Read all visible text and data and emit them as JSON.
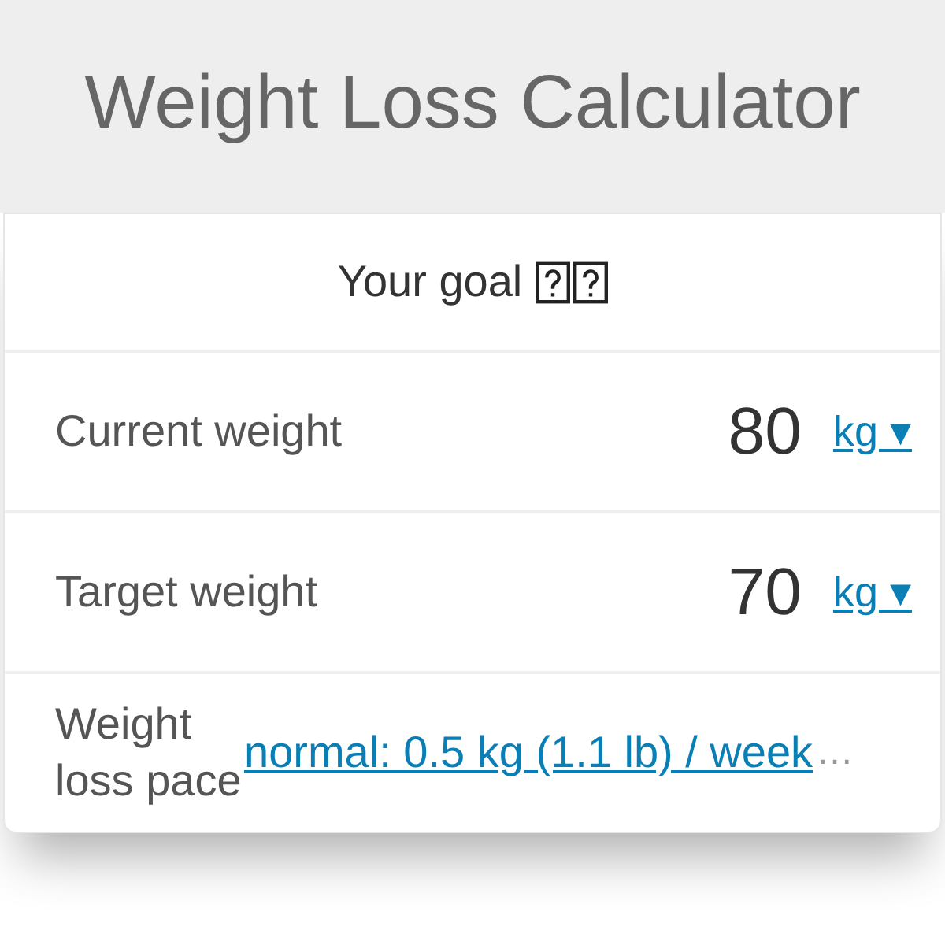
{
  "header": {
    "title": "Weight Loss Calculator"
  },
  "section": {
    "title": "Your goal"
  },
  "fields": [
    {
      "kind": "number",
      "label": "Current weight",
      "value": "80",
      "unit": "kg ▾"
    },
    {
      "kind": "number",
      "label": "Target weight",
      "value": "70",
      "unit": "kg ▾"
    },
    {
      "kind": "select",
      "label": "Weight loss pace",
      "value": "normal: 0.5 kg (1.1 lb) / week",
      "overflow": "…"
    }
  ]
}
